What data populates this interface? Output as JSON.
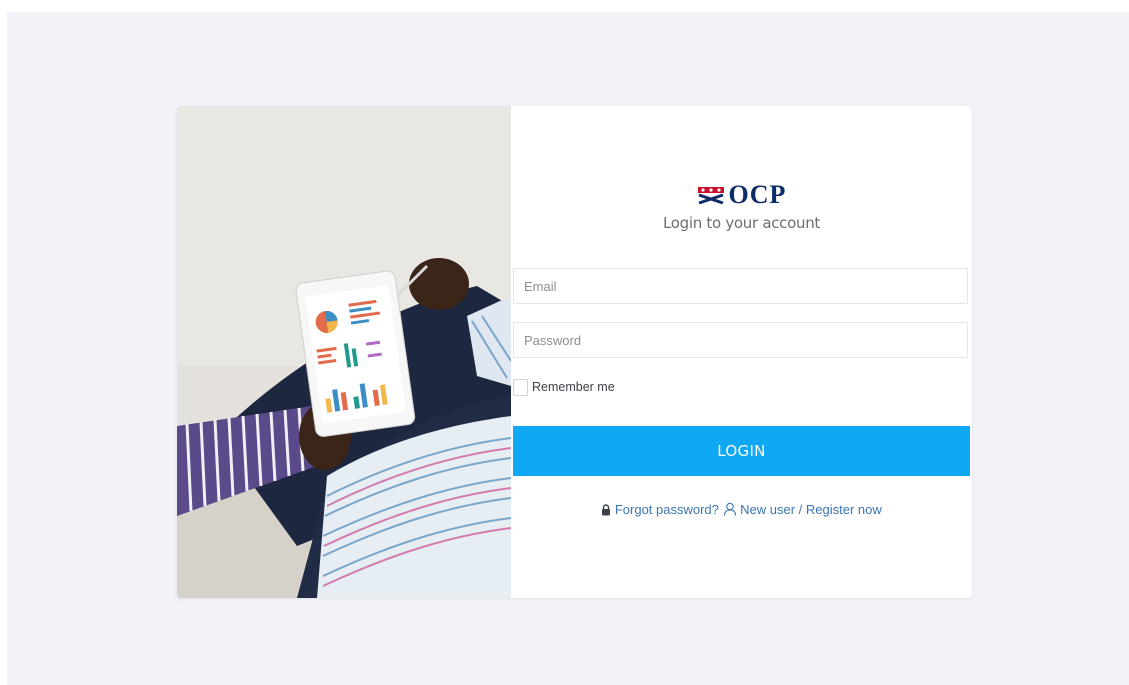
{
  "login": {
    "subtitle": "Login to your account",
    "email_placeholder": "Email",
    "password_placeholder": "Password",
    "remember_label": "Remember me",
    "login_button": "LOGIN",
    "forgot_password": "Forgot password?",
    "new_user": "New user / Register now"
  },
  "brand": {
    "logo_text": "OCP",
    "logo_color": "#0d2b66",
    "accent": "#0ea8f4",
    "link_color": "#3a76b0"
  },
  "icons": {
    "logo": "ocp-emblem-icon",
    "forgot": "lock-icon",
    "register": "user-icon"
  }
}
